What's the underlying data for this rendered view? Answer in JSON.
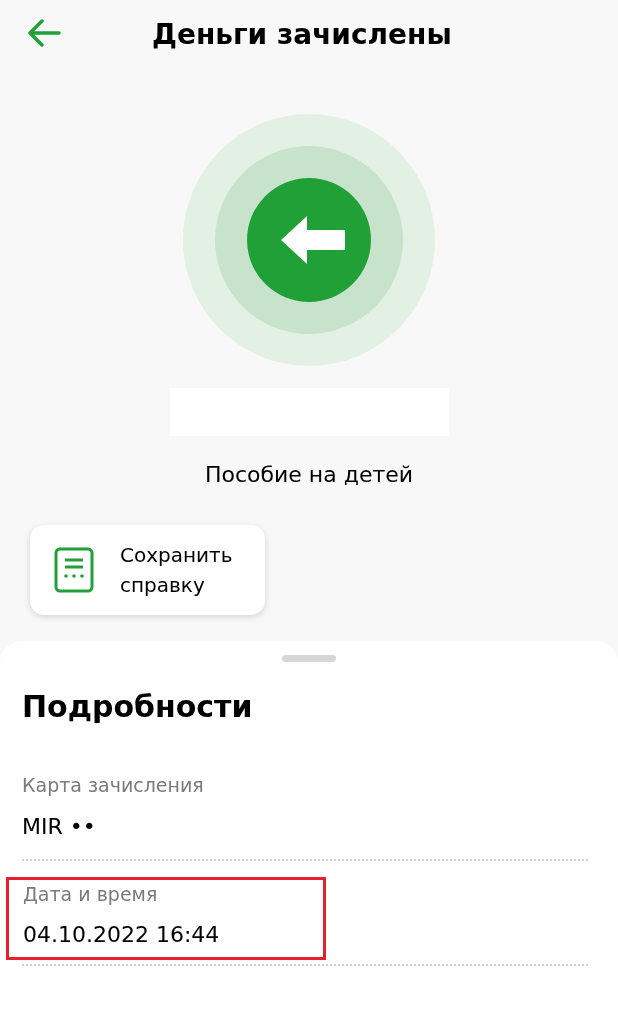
{
  "header": {
    "title": "Деньги зачислены"
  },
  "purpose": "Пособие на детей",
  "save_button": {
    "label": "Сохранить справку"
  },
  "details": {
    "title": "Подробности",
    "items": [
      {
        "label": "Карта зачисления",
        "value": "MIR ••",
        "highlighted": false
      },
      {
        "label": "Дата и время",
        "value": "04.10.2022 16:44",
        "highlighted": true
      }
    ]
  }
}
